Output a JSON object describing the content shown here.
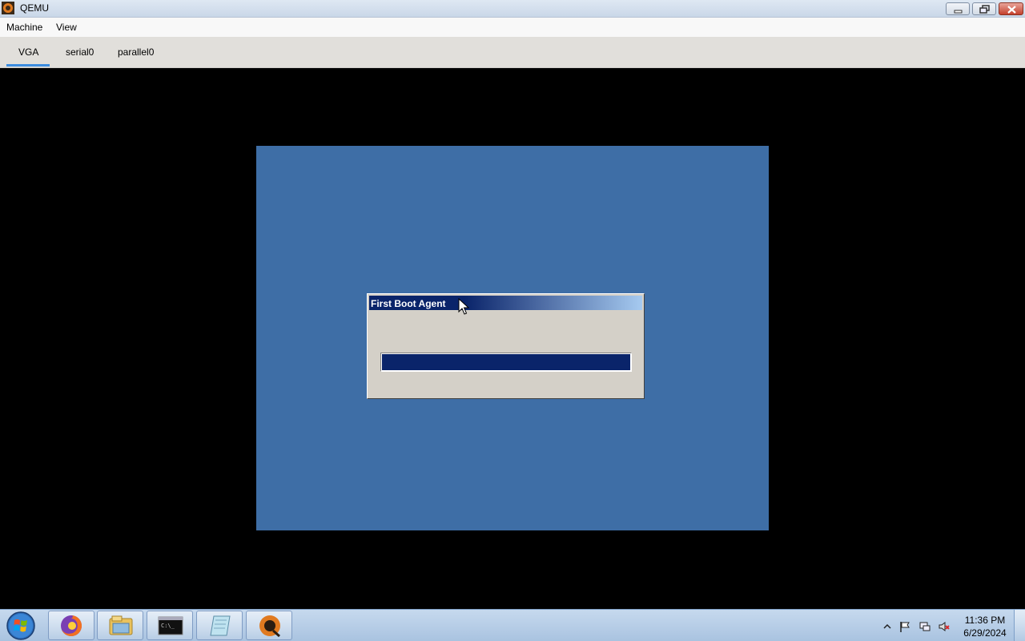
{
  "window": {
    "title": "QEMU",
    "app_icon": "qemu-icon"
  },
  "menubar": {
    "items": [
      "Machine",
      "View"
    ]
  },
  "tabs": {
    "items": [
      "VGA",
      "serial0",
      "parallel0"
    ],
    "active": "VGA"
  },
  "dialog": {
    "title": "First Boot Agent",
    "progress_fraction": 1.0
  },
  "taskbar": {
    "apps": [
      "firefox-icon",
      "file-explorer-icon",
      "command-prompt-icon",
      "notepad-icon",
      "qemu-icon"
    ],
    "tray": [
      "show-hidden-icons-chevron",
      "action-center-flag-icon",
      "network-icon",
      "volume-muted-icon"
    ],
    "clock": {
      "time": "11:36 PM",
      "date": "6/29/2024"
    }
  },
  "colors": {
    "vm_background": "#3e6ea6",
    "dialog_title": "#0a246a",
    "progress_fill": "#0a246a",
    "active_tab_underline": "#3d8de0"
  }
}
